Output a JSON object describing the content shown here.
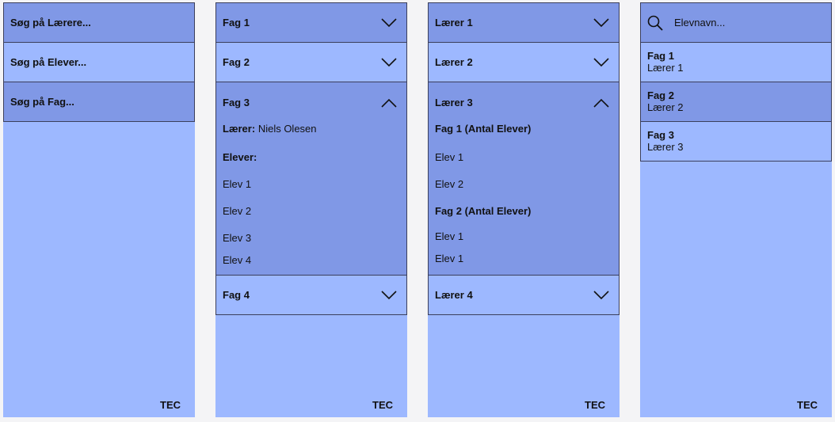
{
  "panel1": {
    "buttons": [
      "Søg på Lærere...",
      "Søg på Elever...",
      "Søg på Fag..."
    ],
    "footer": "TEC"
  },
  "panel2": {
    "items": [
      "Fag 1",
      "Fag 2",
      "Fag 3",
      "Fag 4"
    ],
    "expanded": {
      "teacher_label": "Lærer:",
      "teacher_name": "Niels Olesen",
      "students_label": "Elever:",
      "students": [
        "Elev 1",
        "Elev 2",
        "Elev 3",
        "Elev 4"
      ]
    },
    "footer": "TEC"
  },
  "panel3": {
    "items": [
      "Lærer 1",
      "Lærer 2",
      "Lærer 3",
      "Lærer 4"
    ],
    "expanded": {
      "groups": [
        {
          "title": "Fag 1 (Antal Elever)",
          "students": [
            "Elev 1",
            "Elev 2"
          ]
        },
        {
          "title": "Fag 2 (Antal Elever)",
          "students": [
            "Elev 1",
            "Elev 1"
          ]
        }
      ]
    },
    "footer": "TEC"
  },
  "panel4": {
    "search": {
      "placeholder": "Elevnavn...",
      "icon": "search-icon"
    },
    "results": [
      {
        "subject": "Fag 1",
        "teacher": "Lærer 1"
      },
      {
        "subject": "Fag 2",
        "teacher": "Lærer 2"
      },
      {
        "subject": "Fag 3",
        "teacher": "Lærer 3"
      }
    ],
    "footer": "TEC"
  },
  "colors": {
    "panel_light": "#9db8ff",
    "panel_dark": "#8098e6",
    "border": "#3b3f5c",
    "background": "#f4f4f6"
  }
}
